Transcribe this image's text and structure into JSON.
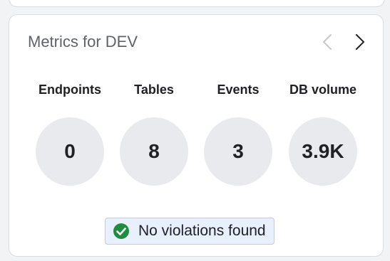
{
  "card": {
    "title": "Metrics for DEV"
  },
  "metrics": [
    {
      "label": "Endpoints",
      "value": "0"
    },
    {
      "label": "Tables",
      "value": "8"
    },
    {
      "label": "Events",
      "value": "3"
    },
    {
      "label": "DB volume",
      "value": "3.9K"
    }
  ],
  "status": {
    "text": "No violations found",
    "icon": "check-circle-icon",
    "color": "#1e8e3e"
  },
  "icons": {
    "prev": "chevron-left-icon",
    "next": "chevron-right-icon"
  }
}
